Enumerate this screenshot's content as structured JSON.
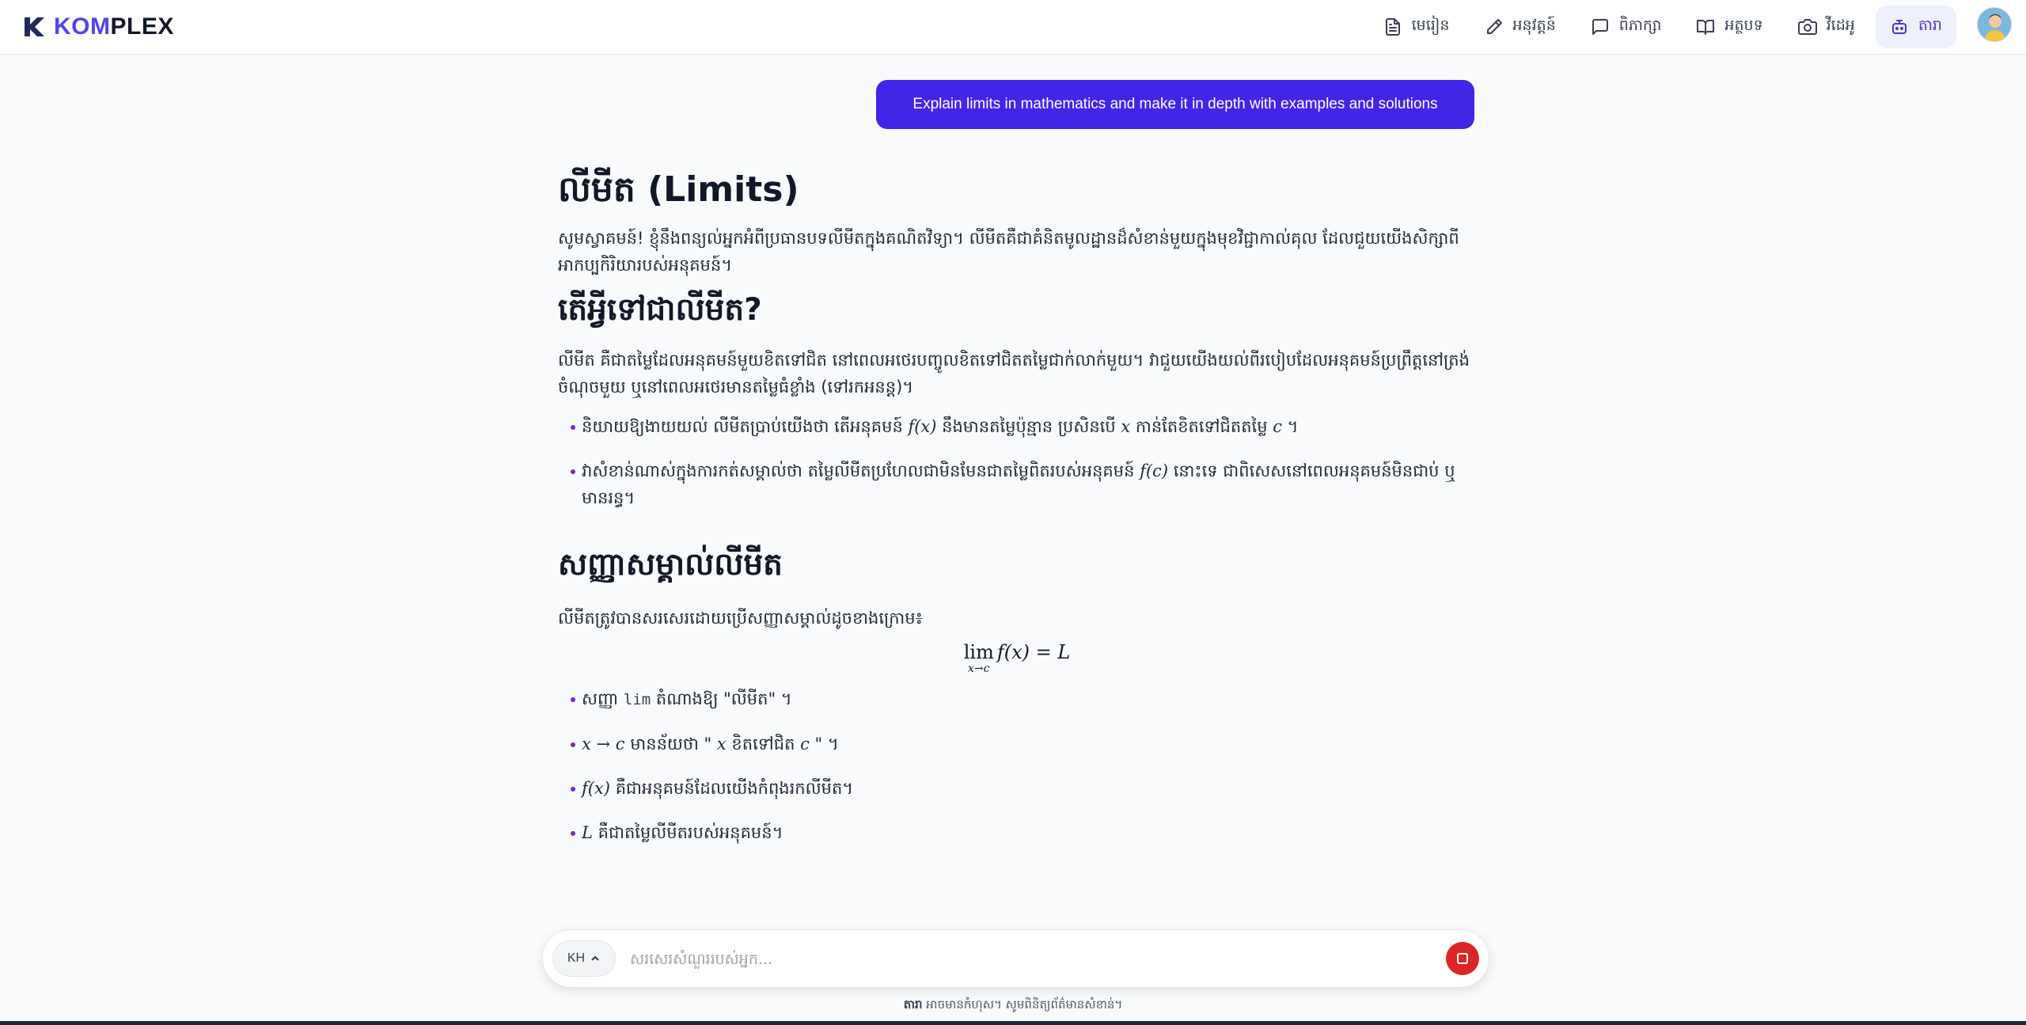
{
  "brand": {
    "part1": "KOM",
    "part2": "PLEX"
  },
  "nav": [
    {
      "label": "មេរៀន",
      "icon": "document-icon"
    },
    {
      "label": "អនុវត្តន៍",
      "icon": "pencil-icon"
    },
    {
      "label": "ពិភាក្សា",
      "icon": "chat-bubble-icon"
    },
    {
      "label": "អត្ថបទ",
      "icon": "book-open-icon"
    },
    {
      "label": "វីដេអូ",
      "icon": "camera-icon"
    },
    {
      "label": "តារា",
      "icon": "robot-icon",
      "active": true
    }
  ],
  "colors": {
    "accent": "#4126e8",
    "active_nav_bg": "#eef0fb",
    "stop": "#dc2626",
    "bullet": "#6d28d9"
  },
  "chat": {
    "user_message": "Explain limits in mathematics and make it in depth with examples and solutions"
  },
  "answer": {
    "title": "លីមីត (Limits)",
    "intro": "សូមស្វាគមន៍! ខ្ញុំនឹងពន្យល់អ្នកអំពីប្រធានបទលីមីតក្នុងគណិតវិទ្យា។ លីមីតគឺជាគំនិតមូលដ្ឋានដ៏សំខាន់មួយក្នុងមុខវិជ្ជាកាល់គុល ដែលជួយយើងសិក្សាពីអាកប្បកិរិយារបស់អនុគមន៍។",
    "section1": {
      "heading": "តើអ្វីទៅជាលីមីត?",
      "para": "លីមីត គឺជាតម្លៃដែលអនុគមន៍មួយខិតទៅជិត នៅពេលអថេរបញ្ចូលខិតទៅជិតតម្លៃជាក់លាក់មួយ។ វាជួយយើងយល់ពីរបៀបដែលអនុគមន៍ប្រព្រឹត្តនៅត្រង់ចំណុចមួយ ឬនៅពេលអថេរមានតម្លៃធំខ្លាំង (ទៅរកអនន្ត)។",
      "b1_a": "និយាយឱ្យងាយយល់ លីមីតប្រាប់យើងថា តើអនុគមន៍ ",
      "b1_m1": "f(x)",
      "b1_b": " នឹងមានតម្លៃប៉ុន្មាន ប្រសិនបើ ",
      "b1_m2": "x",
      "b1_c": " កាន់តែខិតទៅជិតតម្លៃ ",
      "b1_m3": "c",
      "b1_d": " ។",
      "b2_a": "វាសំខាន់ណាស់ក្នុងការកត់សម្គាល់ថា តម្លៃលីមីតប្រហែលជាមិនមែនជាតម្លៃពិតរបស់អនុគមន៍ ",
      "b2_m1": "f(c)",
      "b2_b": " នោះទេ ជាពិសេសនៅពេលអនុគមន៍មិនជាប់ ឬមានរន្ធ។"
    },
    "section2": {
      "heading": "សញ្ញាសម្គាល់លីមីត",
      "para": "លីមីតត្រូវបានសរសេរដោយប្រើសញ្ញាសម្គាល់ដូចខាងក្រោម៖",
      "formula_lim": "lim",
      "formula_sub": "x→c",
      "formula_body": "f(x) = L",
      "b1_a": "សញ្ញា ",
      "b1_code": "lim",
      "b1_b": " តំណាងឱ្យ \"លីមីត\" ។",
      "b2_m1": "x → c",
      "b2_a": " មានន័យថា \" ",
      "b2_m2": "x",
      "b2_b": " ខិតទៅជិត ",
      "b2_m3": "c",
      "b2_c": " \" ។",
      "b3_m1": "f(x)",
      "b3_a": " គឺជាអនុគមន៍ដែលយើងកំពុងរកលីមីត។",
      "b4_m1": "L",
      "b4_a": " គឺជាតម្លៃលីមីតរបស់អនុគមន៍។"
    }
  },
  "composer": {
    "lang": "KH",
    "placeholder": "សរសេរសំណួររបស់អ្នក..."
  },
  "disclaimer": {
    "bold": "តារា",
    "rest": " អាចមានកំហុស។ សូមពិនិត្យព័ត៌មានសំខាន់។"
  }
}
